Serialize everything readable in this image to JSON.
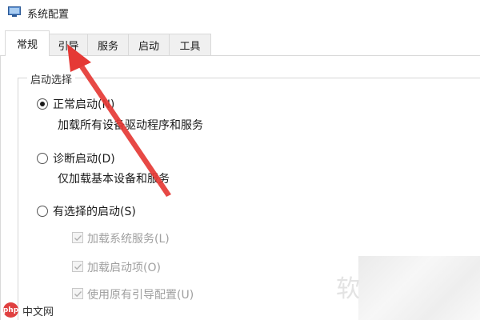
{
  "window": {
    "title": "系统配置"
  },
  "tabs": [
    {
      "label": "常规",
      "active": true
    },
    {
      "label": "引导",
      "active": false
    },
    {
      "label": "服务",
      "active": false
    },
    {
      "label": "启动",
      "active": false
    },
    {
      "label": "工具",
      "active": false
    }
  ],
  "startup": {
    "group_title": "启动选择",
    "options": [
      {
        "label": "正常启动(N)",
        "description": "加载所有设备驱动程序和服务",
        "checked": true
      },
      {
        "label": "诊断启动(D)",
        "description": "仅加载基本设备和服务",
        "checked": false
      },
      {
        "label": "有选择的启动(S)",
        "checked": false
      }
    ],
    "sub_options": [
      {
        "label": "加载系统服务(L)",
        "checked": true,
        "enabled": false
      },
      {
        "label": "加载启动项(O)",
        "checked": true,
        "enabled": false
      },
      {
        "label": "使用原有引导配置(U)",
        "checked": true,
        "enabled": false
      }
    ]
  },
  "annotation": {
    "arrow_color": "#e53935"
  },
  "watermark": {
    "logo": "php",
    "text": "中文网",
    "faint_char": "软"
  },
  "icons": {
    "app": "system-config-icon",
    "radio": "radio-icon",
    "checkbox": "checkbox-icon"
  }
}
